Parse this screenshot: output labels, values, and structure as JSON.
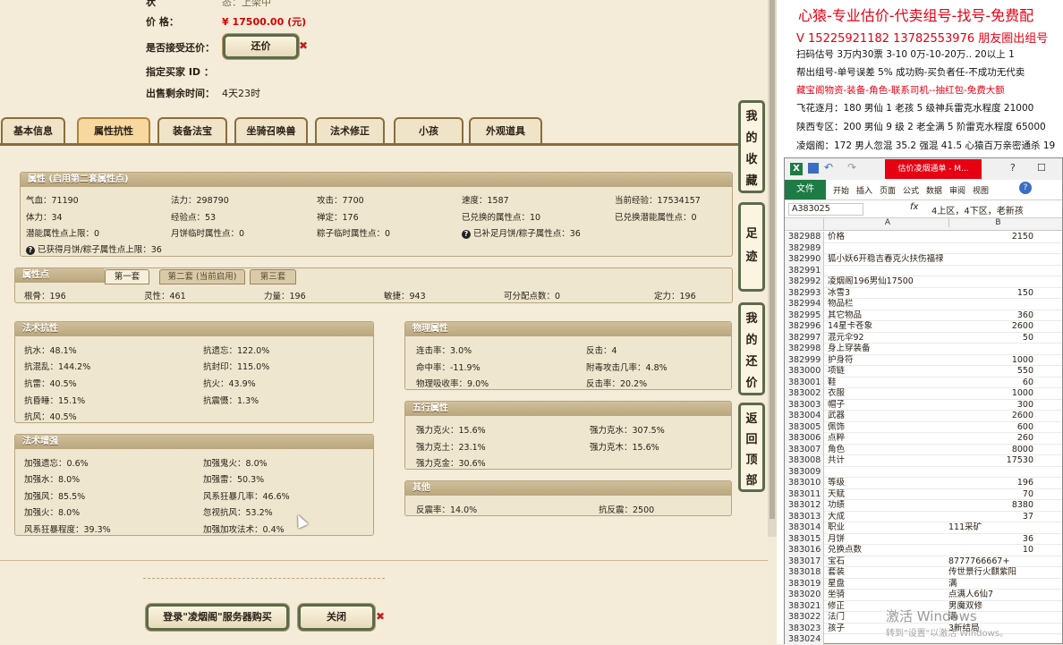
{
  "top": {
    "row0_label": "状",
    "row0_value": "态：上架中",
    "price_label": "价        格：",
    "price_value": "¥ 17500.00 (元)",
    "counter_label": "是否接受还价：",
    "counter_button": "还价",
    "buyer_label": "指定买家 ID ：",
    "remain_label": "出售剩余时间：",
    "remain_value": "4天23时"
  },
  "tabs": [
    "基本信息",
    "属性抗性",
    "装备法宝",
    "坐骑召唤兽",
    "法术修正",
    "小孩",
    "外观道具"
  ],
  "attr": {
    "title": "属性 (启用第二套属性点)",
    "rows": [
      [
        "气血：71190",
        "法力：298790",
        "攻击：7700",
        "速度：1587",
        "当前经验：17534157"
      ],
      [
        "体力：34",
        "经验点：53",
        "禅定：176",
        "已兑换的属性点：10",
        "已兑换潜能属性点：0"
      ],
      [
        "潜能属性点上限：0",
        "月饼临时属性点：0",
        "粽子临时属性点：0",
        "已补足月饼/粽子属性点：36",
        ""
      ]
    ],
    "row4": "已获得月饼/粽子属性点上限：36"
  },
  "points": {
    "title": "属性点",
    "subtabs": [
      "第一套",
      "第二套 (当前启用)",
      "第三套"
    ],
    "values": [
      "根骨：196",
      "灵性：461",
      "力量：196",
      "敏捷：943",
      "可分配点数：0",
      "定力：196"
    ]
  },
  "resist": {
    "title": "法术抗性",
    "left": [
      "抗水：48.1%",
      "抗混乱：144.2%",
      "抗雷：40.5%",
      "抗昏睡：15.1%",
      "抗风：40.5%"
    ],
    "right": [
      "抗遗忘：122.0%",
      "抗封印：115.0%",
      "抗火：43.9%",
      "抗震慑：1.3%"
    ]
  },
  "enhance": {
    "title": "法术增强",
    "left": [
      "加强遗忘：0.6%",
      "加强水：8.0%",
      "加强风：85.5%",
      "加强火：8.0%",
      "风系狂暴程度：39.3%"
    ],
    "right": [
      "加强鬼火：8.0%",
      "加强雷：50.3%",
      "风系狂暴几率：46.6%",
      "忽视抗风：53.2%",
      "加强加攻法术：0.4%"
    ]
  },
  "physical": {
    "title": "物理属性",
    "left": [
      "连击率：3.0%",
      "命中率：-11.9%",
      "物理吸收率：9.0%"
    ],
    "right": [
      "反击：4",
      "附毒攻击几率：4.8%",
      "反击率：20.2%"
    ]
  },
  "wuxing": {
    "title": "五行属性",
    "left": [
      "强力克火：15.6%",
      "强力克土：23.1%",
      "强力克金：30.6%"
    ],
    "right": [
      "强力克水：307.5%",
      "强力克木：15.6%"
    ]
  },
  "other": {
    "title": "其他",
    "left": "反震率：14.0%",
    "right": "抗反震：2500"
  },
  "side_buttons": [
    "我的收藏",
    "足迹",
    "我的还价",
    "返回顶部"
  ],
  "bottom": {
    "buy_button": "登录\"凌烟阁\"服务器购买",
    "close_button": "关闭"
  },
  "ad": {
    "line1": "心猿-专业估价-代卖组号-找号-免费配",
    "line2": "V 15225921182   13782553976 朋友圈出组号",
    "line3": "扫码估号 3万内30票 3-10 0万-10-20万.. 20以上 1",
    "line4": "帮出组号-单号误差 5% 成功购-买负者任-不成功无代卖",
    "line5": "藏宝阁物资-装备-角色-联系司机--抽红包-免费大额",
    "line6": "飞花逐月：180 男仙 1 老孩 5 级神兵雷克水程度 21000",
    "line7": "陕西专区：200 男仙 9 级 2 老全满 5 阶雷克水程度 65000",
    "line8": "凌烟阁：172 男人忽混 35.2 强混 41.5 心猿百万亲密通杀 19"
  },
  "excel": {
    "title": "估价凌烟通单 - M...",
    "ribbon": [
      "文件",
      "开始",
      "插入",
      "页面",
      "公式",
      "数据",
      "审阅",
      "视图"
    ],
    "namebox": "A383025",
    "formula": "4上区，4下区，老新孩",
    "col_a": "A",
    "col_b": "B",
    "rows": [
      [
        "382988",
        "价格",
        "2150"
      ],
      [
        "382989",
        "",
        ""
      ],
      [
        "382990",
        "狐小妖6开稳吉春克火扶伤福禄",
        ""
      ],
      [
        "382991",
        "",
        ""
      ],
      [
        "382992",
        "凌烟阁196男仙17500",
        ""
      ],
      [
        "382993",
        "冰雪3",
        "150"
      ],
      [
        "382994",
        "物品栏",
        ""
      ],
      [
        "382995",
        "其它物品",
        "360"
      ],
      [
        "382996",
        "14星卡苍象",
        "2600"
      ],
      [
        "382997",
        "混元伞92",
        "50"
      ],
      [
        "382998",
        "身上穿装备",
        ""
      ],
      [
        "382999",
        "护身符",
        "1000"
      ],
      [
        "383000",
        "项链",
        "550"
      ],
      [
        "383001",
        "鞋",
        "60"
      ],
      [
        "383002",
        "衣服",
        "1000"
      ],
      [
        "383003",
        "帽子",
        "300"
      ],
      [
        "383004",
        "武器",
        "2600"
      ],
      [
        "383005",
        "佩饰",
        "600"
      ],
      [
        "383006",
        "点粹",
        "260"
      ],
      [
        "383007",
        "角色",
        "8000"
      ],
      [
        "383008",
        "共计",
        "17530"
      ],
      [
        "383009",
        "",
        ""
      ],
      [
        "383010",
        "等级",
        "196"
      ],
      [
        "383011",
        "天赋",
        "70"
      ],
      [
        "383012",
        "功绩",
        "8380"
      ],
      [
        "383013",
        "大成",
        "37"
      ],
      [
        "383014",
        "职业",
        "111采矿"
      ],
      [
        "383015",
        "月饼",
        "36"
      ],
      [
        "383016",
        "兑换点数",
        "10"
      ],
      [
        "383017",
        "宝石",
        "8777766667+"
      ],
      [
        "383018",
        "套装",
        "传世景行火麒紫阳"
      ],
      [
        "383019",
        "星盘",
        "满"
      ],
      [
        "383020",
        "坐骑",
        "点满人6仙7"
      ],
      [
        "383021",
        "修正",
        "男魔双修"
      ],
      [
        "383022",
        "法门",
        "满"
      ],
      [
        "383023",
        "孩子",
        "3新结局"
      ],
      [
        "383024",
        "",
        ""
      ]
    ]
  },
  "watermark": {
    "line1": "激活 Windows",
    "line2": "转到\"设置\"以激活 Windows。"
  }
}
